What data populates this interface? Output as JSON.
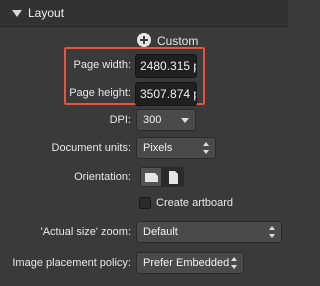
{
  "panel": {
    "title": "Layout",
    "custom_label": "Custom",
    "page_width": {
      "label": "Page width:",
      "value": "2480.315 p"
    },
    "page_height": {
      "label": "Page height:",
      "value": "3507.874 p"
    },
    "dpi": {
      "label": "DPI:",
      "value": "300"
    },
    "document_units": {
      "label": "Document units:",
      "value": "Pixels"
    },
    "orientation": {
      "label": "Orientation:"
    },
    "create_artboard": {
      "label": "Create artboard",
      "checked": false
    },
    "actual_size_zoom": {
      "label": "'Actual size' zoom:",
      "value": "Default"
    },
    "image_placement": {
      "label": "Image placement policy:",
      "value": "Prefer Embedded"
    },
    "colors": {
      "highlight": "#e8533a",
      "background": "#3a3a3a"
    }
  }
}
